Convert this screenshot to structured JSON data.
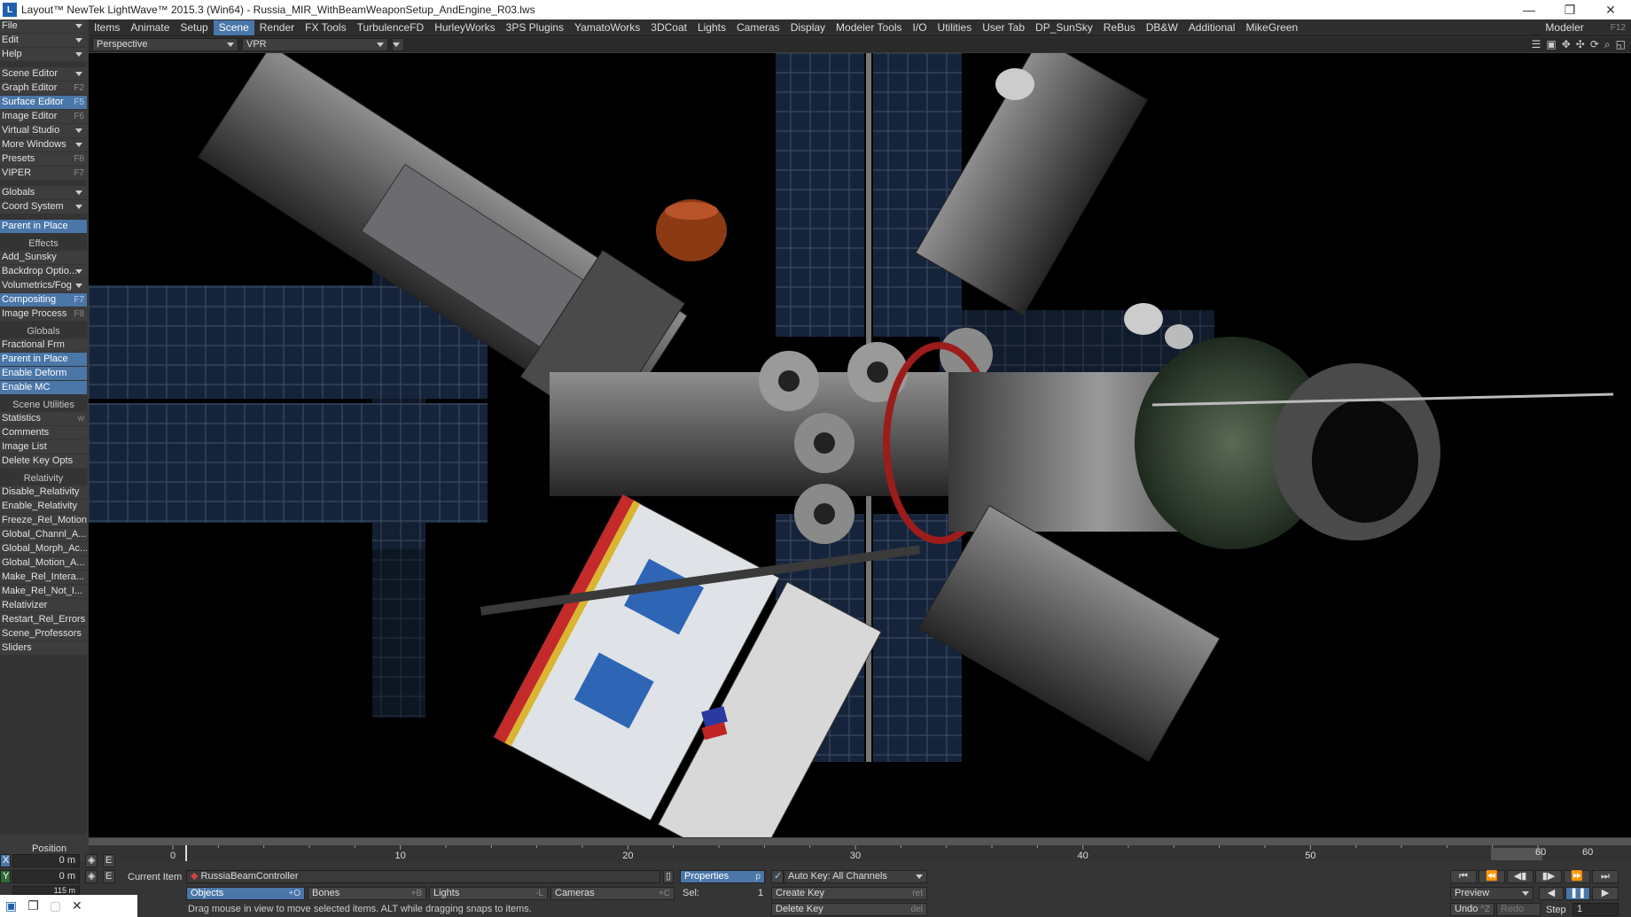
{
  "window": {
    "title": "Layout™ NewTek LightWave™ 2015.3 (Win64) - Russia_MIR_WithBeamWeaponSetup_AndEngine_R03.lws",
    "minimize": "—",
    "restore": "❐",
    "close": "✕"
  },
  "tabs": [
    {
      "label": "Items"
    },
    {
      "label": "Animate"
    },
    {
      "label": "Setup"
    },
    {
      "label": "Scene",
      "active": true
    },
    {
      "label": "Render"
    },
    {
      "label": "FX Tools"
    },
    {
      "label": "TurbulenceFD"
    },
    {
      "label": "HurleyWorks"
    },
    {
      "label": "3PS Plugins"
    },
    {
      "label": "YamatoWorks"
    },
    {
      "label": "3DCoat"
    },
    {
      "label": "Lights"
    },
    {
      "label": "Cameras"
    },
    {
      "label": "Display"
    },
    {
      "label": "Modeler Tools"
    },
    {
      "label": "I/O"
    },
    {
      "label": "Utilities"
    },
    {
      "label": "User Tab"
    },
    {
      "label": "DP_SunSky"
    },
    {
      "label": "ReBus"
    },
    {
      "label": "DB&W"
    },
    {
      "label": "Additional"
    },
    {
      "label": "MikeGreen"
    }
  ],
  "modeler": {
    "label": "Modeler",
    "key": "F12"
  },
  "viewbar": {
    "view_mode": "Perspective",
    "render_mode": "VPR"
  },
  "sidebar": {
    "menus": [
      {
        "label": "File"
      },
      {
        "label": "Edit"
      },
      {
        "label": "Help"
      }
    ],
    "windows": [
      {
        "label": "Scene Editor",
        "dd": true
      },
      {
        "label": "Graph Editor",
        "key": "F2"
      },
      {
        "label": "Surface Editor",
        "key": "F5",
        "hl": true
      },
      {
        "label": "Image Editor",
        "key": "F6"
      },
      {
        "label": "Virtual Studio",
        "dd": true
      },
      {
        "label": "More Windows",
        "dd": true
      },
      {
        "label": "Presets",
        "key": "F8"
      },
      {
        "label": "VIPER",
        "key": "F7"
      }
    ],
    "globals_dd": [
      {
        "label": "Globals",
        "dd": true
      },
      {
        "label": "Coord System",
        "dd": true
      }
    ],
    "parent_in_place": "Parent in Place",
    "effects_header": "Effects",
    "effects": [
      {
        "label": "Add_Sunsky"
      },
      {
        "label": "Backdrop Optio...",
        "dd": true
      },
      {
        "label": "Volumetrics/Fog",
        "dd": true
      },
      {
        "label": "Compositing",
        "key": "F7",
        "hl": true
      },
      {
        "label": "Image Process",
        "key": "F8"
      }
    ],
    "globals_header": "Globals",
    "globals": [
      {
        "label": "Fractional Frm"
      },
      {
        "label": "Parent in Place",
        "hl": true
      },
      {
        "label": "Enable Deform",
        "hl": true
      },
      {
        "label": "Enable MC",
        "hl": true
      }
    ],
    "utilities_header": "Scene Utilities",
    "utilities": [
      {
        "label": "Statistics",
        "key": "w"
      },
      {
        "label": "Comments"
      },
      {
        "label": "Image List"
      },
      {
        "label": "Delete Key Opts"
      }
    ],
    "relativity_header": "Relativity",
    "relativity": [
      {
        "label": "Disable_Relativity"
      },
      {
        "label": "Enable_Relativity"
      },
      {
        "label": "Freeze_Rel_Motion"
      },
      {
        "label": "Global_Channl_A..."
      },
      {
        "label": "Global_Morph_Ac..."
      },
      {
        "label": "Global_Motion_A..."
      },
      {
        "label": "Make_Rel_Intera..."
      },
      {
        "label": "Make_Rel_Not_I..."
      },
      {
        "label": "Relativizer"
      },
      {
        "label": "Restart_Rel_Errors"
      },
      {
        "label": "Scene_Professors"
      },
      {
        "label": "Sliders"
      }
    ]
  },
  "timeline": {
    "ticks": [
      "0",
      "10",
      "20",
      "30",
      "40",
      "50",
      "60"
    ],
    "end_field": "60",
    "end_value": "60"
  },
  "bottom": {
    "position_label": "Position",
    "x_label": "X",
    "x_value": "0 m",
    "y_label": "Y",
    "y_value": "0 m",
    "z_value": "115 m",
    "current_item_label": "Current Item",
    "current_item": "RussiaBeamController",
    "objects": "Objects",
    "objects_key": "+O",
    "bones": "Bones",
    "bones_key": "+B",
    "lights": "Lights",
    "lights_key": "-L",
    "cameras": "Cameras",
    "cameras_key": "+C",
    "properties": "Properties",
    "properties_key": "p",
    "sel_label": "Sel:",
    "sel_value": "1",
    "auto_key": "Auto Key: All Channels",
    "create_key": "Create Key",
    "create_key_key": "ret",
    "delete_key": "Delete Key",
    "delete_key_key": "del",
    "status": "Drag mouse in view to move selected items. ALT while dragging snaps to items.",
    "preview": "Preview",
    "undo": "Undo",
    "undo_key": "^Z",
    "redo": "Redo",
    "step_label": "Step",
    "step_value": "1"
  },
  "colors": {
    "accent": "#4a76a8",
    "panel": "#353535",
    "viewport": "#000000"
  }
}
